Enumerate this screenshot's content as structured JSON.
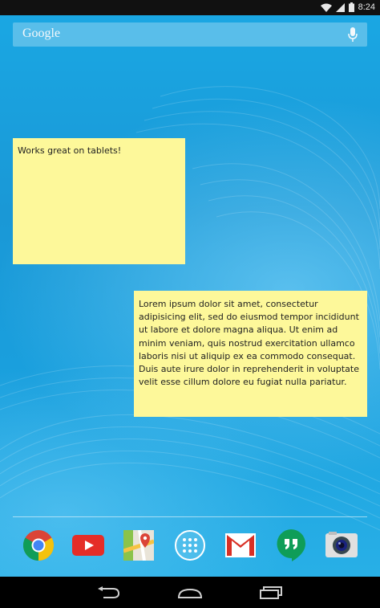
{
  "status_bar": {
    "time": "8:24",
    "icons": [
      "wifi-icon",
      "signal-icon",
      "battery-icon"
    ]
  },
  "search": {
    "label": "Google",
    "icon": "mic-icon"
  },
  "notes": [
    {
      "text": "Works great on tablets!",
      "color": "#fdf89a"
    },
    {
      "text": "Lorem ipsum dolor sit amet, consectetur adipisicing elit, sed do eiusmod tempor incididunt ut labore et dolore magna aliqua. Ut enim ad minim veniam, quis nostrud exercitation ullamco laboris nisi ut aliquip ex ea commodo consequat. Duis aute irure dolor in reprehenderit in voluptate velit esse cillum dolore eu fugiat nulla pariatur.",
      "color": "#fdf89a"
    }
  ],
  "dock": {
    "apps": [
      "chrome-icon",
      "youtube-icon",
      "maps-icon",
      "app-drawer-icon",
      "gmail-icon",
      "hangouts-icon",
      "camera-icon"
    ]
  },
  "nav_bar": {
    "buttons": [
      "back-icon",
      "home-icon",
      "recents-icon"
    ]
  },
  "colors": {
    "wallpaper": "#1a9fd8",
    "note": "#fdf89a",
    "status_bar": "#111111",
    "nav_bar": "#000000"
  }
}
